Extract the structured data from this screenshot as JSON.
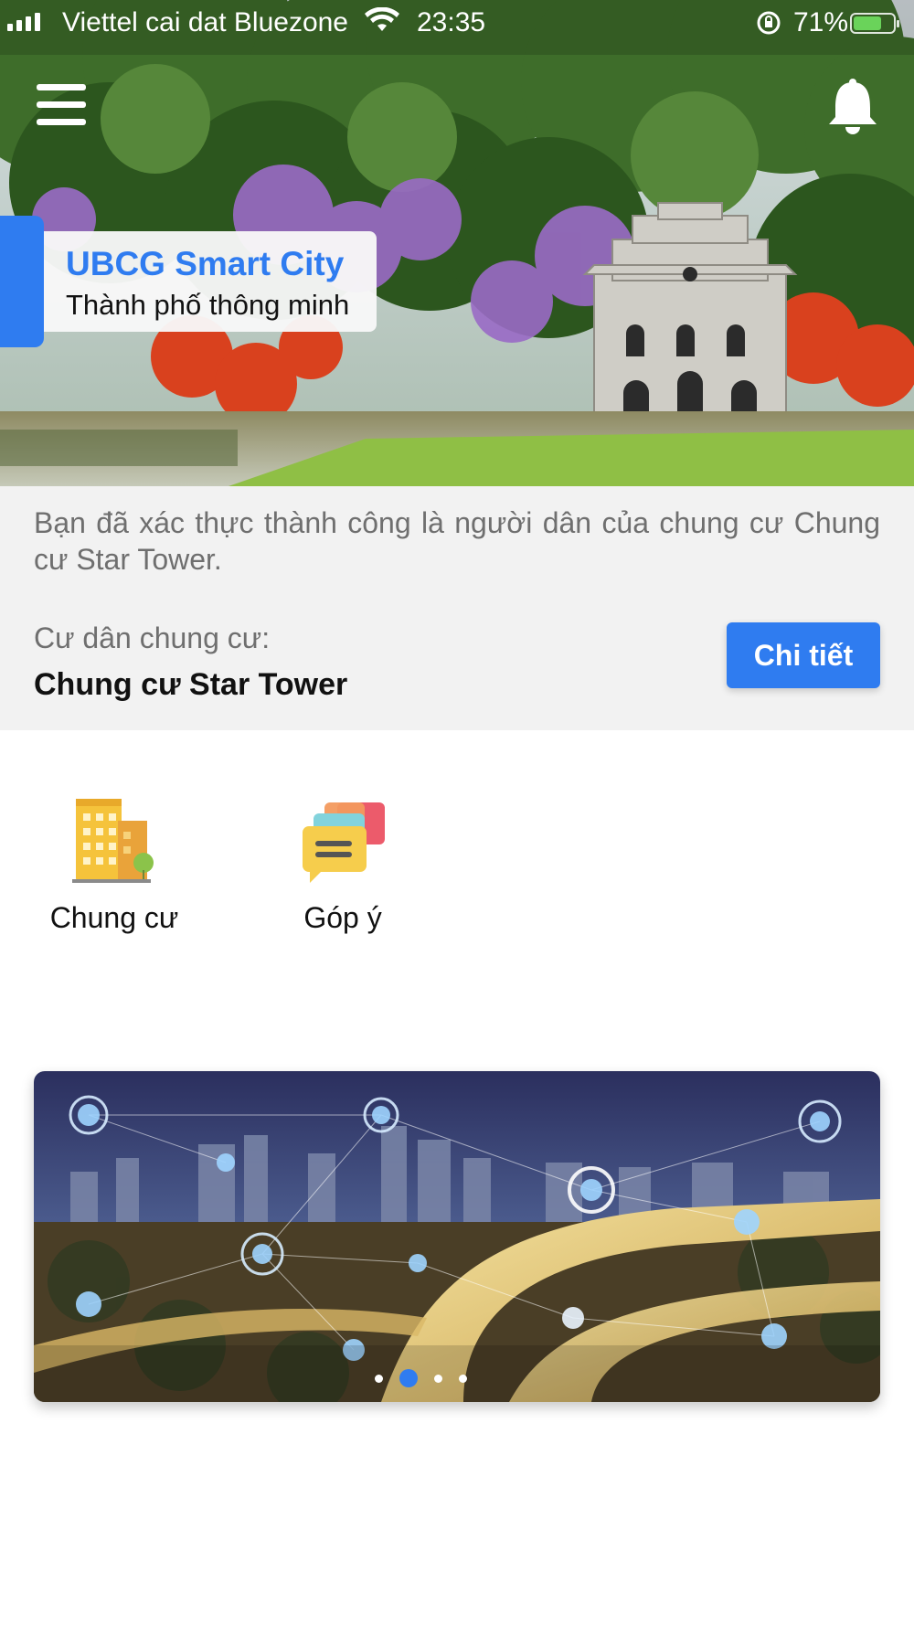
{
  "status_bar": {
    "carrier": "Viettel cai dat Bluezone",
    "time": "23:35",
    "battery_percent_label": "71%",
    "battery_level": 0.71,
    "icons": [
      "signal-icon",
      "wifi-icon",
      "orientation-lock-icon",
      "battery-charging-icon"
    ]
  },
  "header": {
    "menu_icon": "hamburger-menu-icon",
    "notification_icon": "bell-icon",
    "brand_title": "UBCG Smart City",
    "brand_subtitle": "Thành phố thông minh"
  },
  "verification": {
    "message": "Bạn đã xác thực thành công là người dân của chung cư Chung cư Star Tower.",
    "resident_label": "Cư dân chung cư:",
    "building_name": "Chung cư Star Tower",
    "detail_button": "Chi tiết"
  },
  "features": [
    {
      "label": "Chung cư",
      "icon": "apartment-building-icon"
    },
    {
      "label": "Góp ý",
      "icon": "feedback-chat-icon"
    }
  ],
  "banner": {
    "slide_count": 4,
    "active_index": 1
  },
  "colors": {
    "accent": "#2f7cf0",
    "info_background": "#f2f2f2",
    "muted_text": "#6f6f6f"
  }
}
